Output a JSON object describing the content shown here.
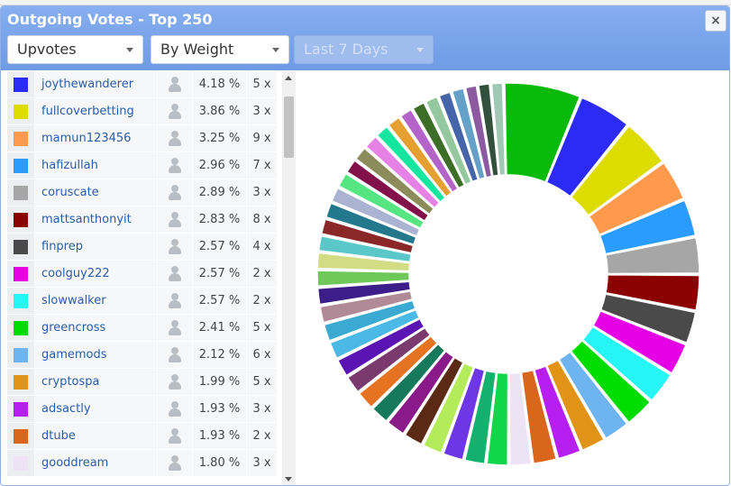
{
  "panel": {
    "title": "Outgoing Votes - Top 250",
    "close_label": "×"
  },
  "filters": {
    "type": "Upvotes",
    "sort": "By Weight",
    "period": "Last 7 Days"
  },
  "icons": {
    "close": "close-icon",
    "dropdown": "chevron-down-icon",
    "profile": "user-icon",
    "scroll_up": "arrow-up-icon",
    "scroll_down": "arrow-down-icon"
  },
  "rows": [
    {
      "name": "joythewanderer",
      "pct": "4.18 %",
      "count": "5 x",
      "color": "#2b2bf5"
    },
    {
      "name": "fullcoverbetting",
      "pct": "3.86 %",
      "count": "3 x",
      "color": "#dcdc00"
    },
    {
      "name": "mamun123456",
      "pct": "3.25 %",
      "count": "9 x",
      "color": "#ff9a4d"
    },
    {
      "name": "hafizullah",
      "pct": "2.96 %",
      "count": "7 x",
      "color": "#2a9bff"
    },
    {
      "name": "coruscate",
      "pct": "2.89 %",
      "count": "3 x",
      "color": "#a6a6a6"
    },
    {
      "name": "mattsanthonyit",
      "pct": "2.83 %",
      "count": "8 x",
      "color": "#8b0000"
    },
    {
      "name": "finprep",
      "pct": "2.57 %",
      "count": "4 x",
      "color": "#4a4a4a"
    },
    {
      "name": "coolguy222",
      "pct": "2.57 %",
      "count": "2 x",
      "color": "#e600e6"
    },
    {
      "name": "slowwalker",
      "pct": "2.57 %",
      "count": "2 x",
      "color": "#26f5f5"
    },
    {
      "name": "greencross",
      "pct": "2.41 %",
      "count": "5 x",
      "color": "#00dc00"
    },
    {
      "name": "gamemods",
      "pct": "2.12 %",
      "count": "6 x",
      "color": "#6db4f0"
    },
    {
      "name": "cryptospa",
      "pct": "1.99 %",
      "count": "5 x",
      "color": "#e09316"
    },
    {
      "name": "adsactly",
      "pct": "1.93 %",
      "count": "3 x",
      "color": "#b61ff0"
    },
    {
      "name": "dtube",
      "pct": "1.93 %",
      "count": "2 x",
      "color": "#d9661a"
    },
    {
      "name": "gooddream",
      "pct": "1.80 %",
      "count": "3 x",
      "color": "#ede3f5"
    }
  ],
  "chart": {
    "type": "donut",
    "values": [
      6.0,
      4.18,
      3.86,
      3.25,
      2.96,
      2.89,
      2.83,
      2.57,
      2.57,
      2.57,
      2.41,
      2.12,
      1.99,
      1.93,
      1.93,
      1.8,
      1.75,
      1.7,
      1.7,
      1.65,
      1.6,
      1.6,
      1.55,
      1.55,
      1.5,
      1.5,
      1.45,
      1.45,
      1.4,
      1.4,
      1.35,
      1.35,
      1.3,
      1.3,
      1.3,
      1.25,
      1.25,
      1.2,
      1.2,
      1.2,
      1.15,
      1.15,
      1.1,
      1.1,
      1.1,
      1.05,
      1.05,
      1.0,
      1.0,
      1.0
    ],
    "colors": [
      "#0aba0a",
      "#2b2bf5",
      "#dcdc00",
      "#ff9a4d",
      "#2a9bff",
      "#a6a6a6",
      "#8b0000",
      "#4a4a4a",
      "#e600e6",
      "#26f5f5",
      "#00dc00",
      "#6db4f0",
      "#e09316",
      "#b61ff0",
      "#d9661a",
      "#ede3f5",
      "#12d64a",
      "#14b06e",
      "#6e37e6",
      "#b4eb5a",
      "#5a2a14",
      "#8a1a8a",
      "#167a5a",
      "#e67322",
      "#7a3a6e",
      "#5a14b4",
      "#4ab9e6",
      "#3aaad2",
      "#b08a96",
      "#3c1e8a",
      "#6ec85a",
      "#d2dc82",
      "#5ac8c8",
      "#8a2828",
      "#23788c",
      "#aab4d2",
      "#55e682",
      "#82104a",
      "#8c8c5a",
      "#e682e6",
      "#14e6a0",
      "#e6a032",
      "#b464c8",
      "#3c6e28",
      "#96c8a0",
      "#4664aa",
      "#64a0c8",
      "#8c5aa0",
      "#32503c",
      "#a0c8b4"
    ]
  }
}
